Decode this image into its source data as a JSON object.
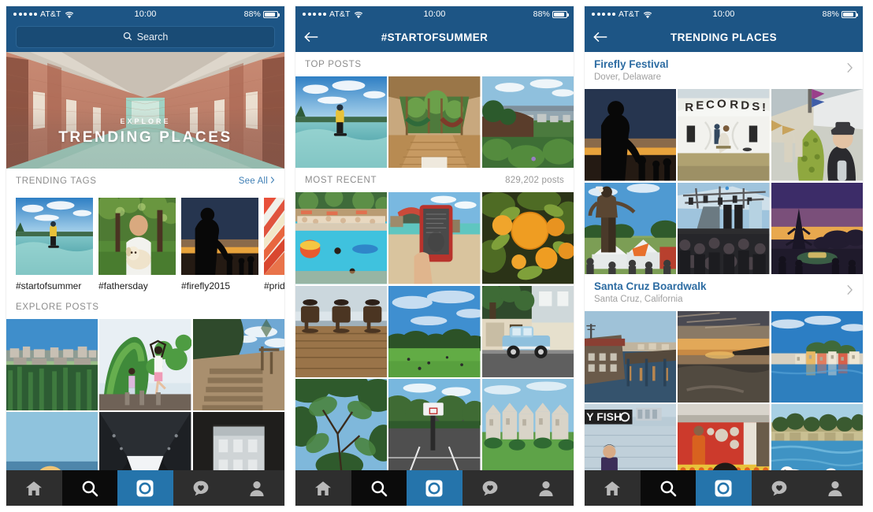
{
  "status_bar": {
    "carrier": "AT&T",
    "signal_dots": 5,
    "time": "10:00",
    "battery_percent": "88%"
  },
  "colors": {
    "nav_blue": "#1d5585",
    "search_field_blue": "#194b75",
    "link_blue": "#3f7fb5",
    "place_title_blue": "#2d6ca2",
    "section_label_gray": "#8c8c8c",
    "tab_active_blue": "#2574ab",
    "tab_dark": "#2e2e2e",
    "tab_black": "#0b0b0b"
  },
  "panels": [
    {
      "id": "explore",
      "search": {
        "placeholder": "Search",
        "icon": "search-icon"
      },
      "hero": {
        "kicker": "EXPLORE",
        "title": "TRENDING PLACES",
        "art": "brick-corridor"
      },
      "trending_tags": {
        "header": "TRENDING TAGS",
        "action": "See All",
        "action_icon": "chevron-right-icon",
        "items": [
          {
            "label": "#startofsummer",
            "art": "wakeboard"
          },
          {
            "label": "#fathersday",
            "art": "man-puppy"
          },
          {
            "label": "#firefly2015",
            "art": "sunset-silhouette"
          },
          {
            "label": "#prid",
            "art": "pride-stripes"
          }
        ]
      },
      "explore_posts": {
        "header": "EXPLORE POSTS",
        "items": [
          {
            "art": "hillside-city"
          },
          {
            "art": "yoga-greenery"
          },
          {
            "art": "dirt-stairs"
          },
          {
            "art": "sunhat-beach"
          },
          {
            "art": "dark-tunnel"
          },
          {
            "art": "archway-building"
          }
        ]
      }
    },
    {
      "id": "hashtag",
      "back_icon": "back-arrow-icon",
      "title": "#STARTOFSUMMER",
      "top_posts": {
        "header": "TOP POSTS",
        "items": [
          {
            "art": "wakeboard"
          },
          {
            "art": "cabin-hammocks"
          },
          {
            "art": "bay-overlook"
          }
        ]
      },
      "most_recent": {
        "header": "MOST RECENT",
        "count": "829,202 posts",
        "items": [
          {
            "art": "pool-party"
          },
          {
            "art": "ereader-beach"
          },
          {
            "art": "oranges-tree"
          },
          {
            "art": "deck-chairs"
          },
          {
            "art": "park-sky"
          },
          {
            "art": "blue-truck"
          },
          {
            "art": "tree-canopy"
          },
          {
            "art": "basketball-court"
          },
          {
            "art": "painted-ladies"
          }
        ]
      }
    },
    {
      "id": "places",
      "back_icon": "back-arrow-icon",
      "title": "TRENDING PLACES",
      "places": [
        {
          "name": "Firefly Festival",
          "location": "Dover, Delaware",
          "chevron": "chevron-right-icon",
          "items": [
            {
              "art": "sunset-silhouette"
            },
            {
              "art": "records-tent"
            },
            {
              "art": "festival-costume"
            },
            {
              "art": "stilt-walker"
            },
            {
              "art": "concert-stage"
            },
            {
              "art": "dusk-festival"
            }
          ]
        },
        {
          "name": "Santa Cruz Boardwalk",
          "location": "Santa Cruz, California",
          "chevron": "chevron-right-icon",
          "items": [
            {
              "art": "wharf-dusk"
            },
            {
              "art": "beach-sunset"
            },
            {
              "art": "harbor-houses"
            },
            {
              "art": "fish-sign"
            },
            {
              "art": "red-stall"
            },
            {
              "art": "seagulls-water"
            }
          ]
        }
      ]
    }
  ],
  "tab_bar": {
    "tabs": [
      {
        "name": "home",
        "icon": "home-icon",
        "active": false
      },
      {
        "name": "search",
        "icon": "search-icon",
        "active": false
      },
      {
        "name": "camera",
        "icon": "camera-icon",
        "active": true
      },
      {
        "name": "activity",
        "icon": "heart-bubble-icon",
        "active": false
      },
      {
        "name": "profile",
        "icon": "person-icon",
        "active": false
      }
    ]
  }
}
